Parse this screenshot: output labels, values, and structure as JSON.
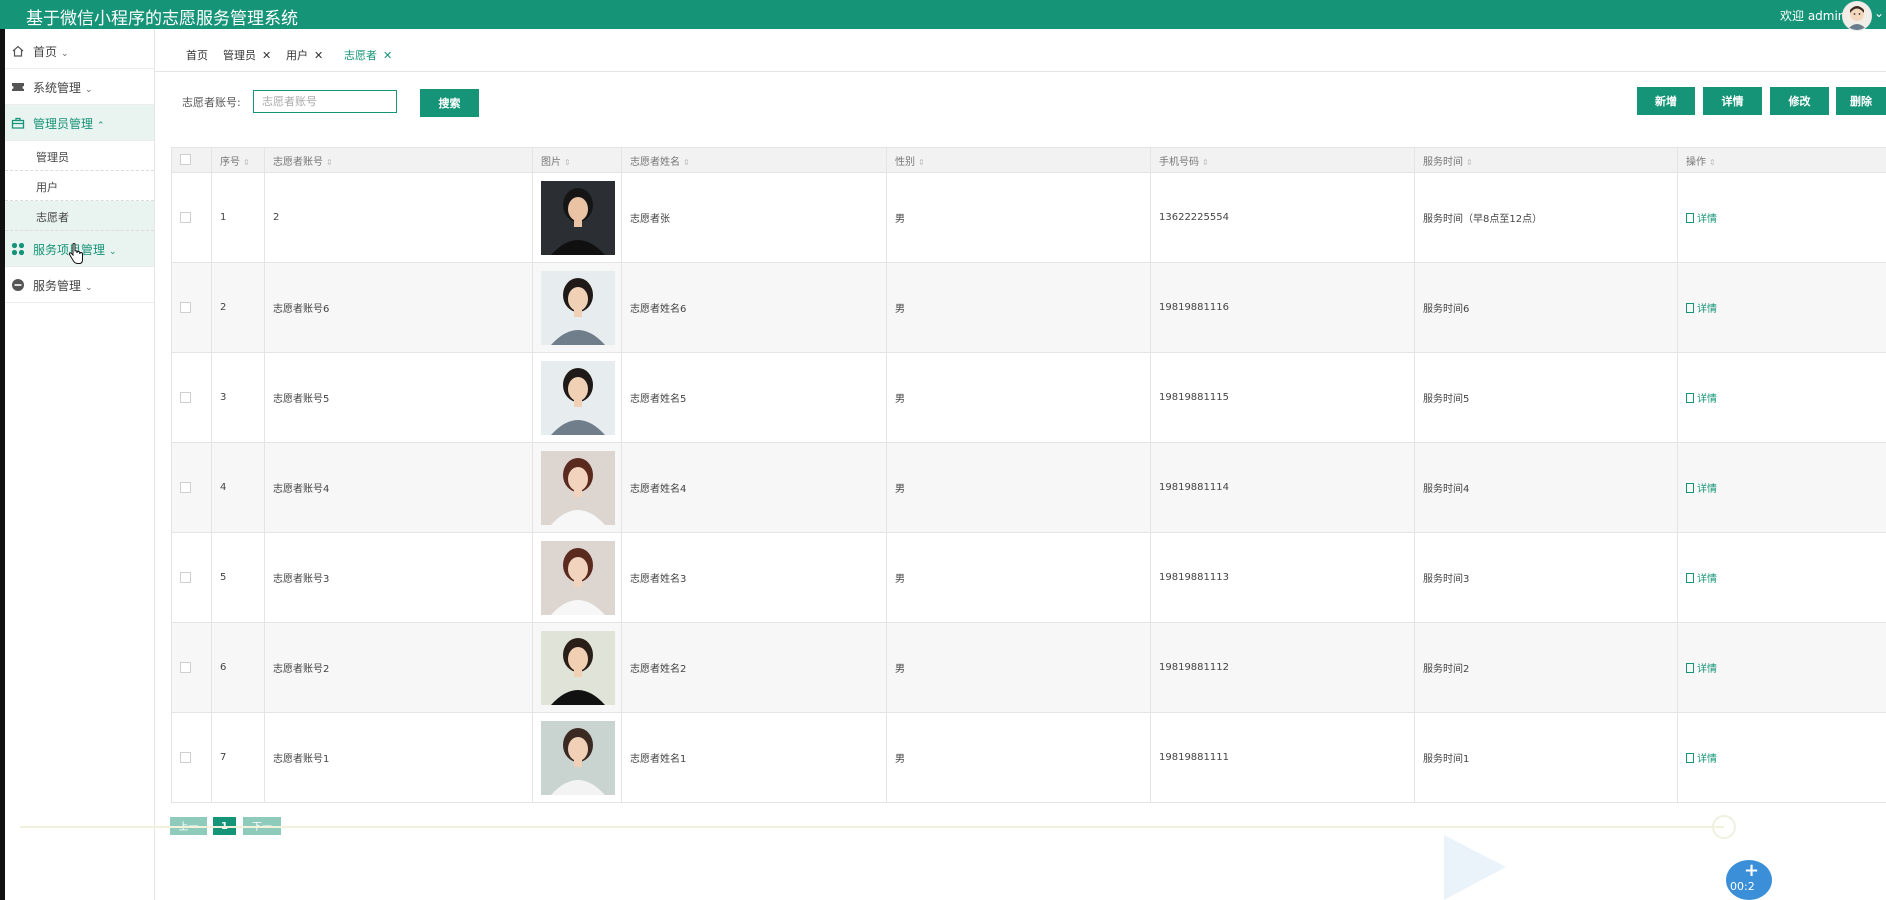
{
  "header": {
    "title": "基于微信小程序的志愿服务管理系统",
    "welcome": "欢迎 admin"
  },
  "sidebar": {
    "items": [
      {
        "label": "首页",
        "icon": "home-icon"
      },
      {
        "label": "系统管理",
        "icon": "ticket-icon"
      },
      {
        "label": "管理员管理",
        "icon": "briefcase-icon"
      },
      {
        "label": "服务项目管理",
        "icon": "grid-icon"
      },
      {
        "label": "服务管理",
        "icon": "minus-circle-icon"
      }
    ],
    "subitems": [
      "管理员",
      "用户",
      "志愿者"
    ]
  },
  "tabs": [
    {
      "label": "首页"
    },
    {
      "label": "管理员"
    },
    {
      "label": "用户"
    },
    {
      "label": "志愿者"
    }
  ],
  "search": {
    "label": "志愿者账号:",
    "placeholder": "志愿者账号",
    "button": "搜索"
  },
  "toolbar": {
    "add": "新增",
    "detail": "详情",
    "edit": "修改",
    "delete": "删除"
  },
  "table": {
    "columns": [
      "序号",
      "志愿者账号",
      "图片",
      "志愿者姓名",
      "性别",
      "手机号码",
      "服务时间",
      "操作"
    ],
    "rows": [
      {
        "no": "1",
        "account": "2",
        "name": "志愿者张",
        "gender": "男",
        "phone": "13622225554",
        "time": "服务时间（早8点至12点）",
        "action": "详情"
      },
      {
        "no": "2",
        "account": "志愿者账号6",
        "name": "志愿者姓名6",
        "gender": "男",
        "phone": "19819881116",
        "time": "服务时间6",
        "action": "详情"
      },
      {
        "no": "3",
        "account": "志愿者账号5",
        "name": "志愿者姓名5",
        "gender": "男",
        "phone": "19819881115",
        "time": "服务时间5",
        "action": "详情"
      },
      {
        "no": "4",
        "account": "志愿者账号4",
        "name": "志愿者姓名4",
        "gender": "男",
        "phone": "19819881114",
        "time": "服务时间4",
        "action": "详情"
      },
      {
        "no": "5",
        "account": "志愿者账号3",
        "name": "志愿者姓名3",
        "gender": "男",
        "phone": "19819881113",
        "time": "服务时间3",
        "action": "详情"
      },
      {
        "no": "6",
        "account": "志愿者账号2",
        "name": "志愿者姓名2",
        "gender": "男",
        "phone": "19819881112",
        "time": "服务时间2",
        "action": "详情"
      },
      {
        "no": "7",
        "account": "志愿者账号1",
        "name": "志愿者姓名1",
        "gender": "男",
        "phone": "19819881111",
        "time": "服务时间1",
        "action": "详情"
      }
    ]
  },
  "pagination": {
    "prev": "上一页",
    "current": "1",
    "next": "下一页"
  },
  "overlay": {
    "timer": "00:2"
  },
  "colors": {
    "brand": "#169478",
    "header_bg": "#169478",
    "active_bg": "#e9f3f0"
  }
}
